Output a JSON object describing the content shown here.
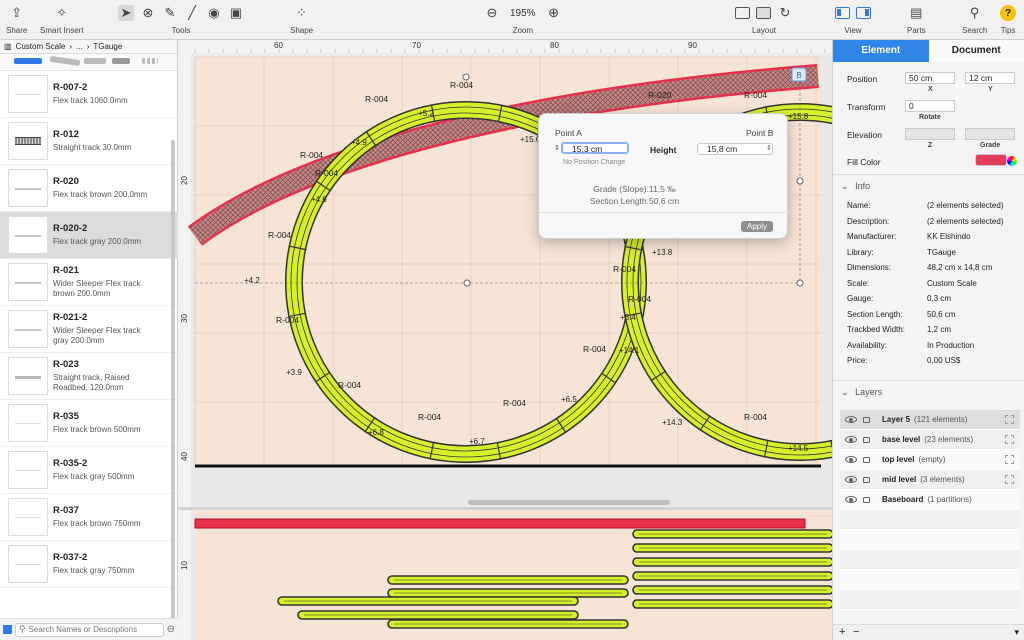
{
  "toolbar": {
    "share_label": "Share",
    "smart_insert_label": "Smart Insert",
    "tools_label": "Tools",
    "shape_label": "Shape",
    "zoom_label": "Zoom",
    "zoom_value": "195%",
    "layout_label": "Layout",
    "view_label": "View",
    "parts_label": "Parts",
    "search_label": "Search",
    "tips_label": "Tips"
  },
  "breadcrumb": {
    "root": "Custom Scale",
    "ellipsis": "...",
    "current": "TGauge"
  },
  "library": {
    "items": [
      {
        "title": "R-007-2",
        "desc": "Flex track 1060.0mm"
      },
      {
        "title": "R-012",
        "desc": "Straight track 30.0mm"
      },
      {
        "title": "R-020",
        "desc": "Flex track brown 200.0mm"
      },
      {
        "title": "R-020-2",
        "desc": "Flex track gray 200.0mm"
      },
      {
        "title": "R-021",
        "desc": "Wider Sleeper Flex track brown 200.0mm"
      },
      {
        "title": "R-021-2",
        "desc": "Wider Sleeper Flex track gray 200.0mm"
      },
      {
        "title": "R-023",
        "desc": "Straight track, Raised Roadbed, 120.0mm"
      },
      {
        "title": "R-035",
        "desc": "Flex track brown 500mm"
      },
      {
        "title": "R-035-2",
        "desc": "Flex track gray 500mm"
      },
      {
        "title": "R-037",
        "desc": "Flex track brown 750mm"
      },
      {
        "title": "R-037-2",
        "desc": "Flex track gray 750mm"
      }
    ],
    "selected_index": 3,
    "search_placeholder": "Search Names or Descriptions"
  },
  "canvas": {
    "ruler_top": [
      "60",
      "70",
      "80",
      "90"
    ],
    "ruler_left": [
      "20",
      "30",
      "40"
    ],
    "ruler_left_lower": [
      "10"
    ],
    "track_label": "R-004",
    "track_label_top": "R-020",
    "endpoint_badge": "B",
    "elevations": [
      "+5.2",
      "+4.9",
      "+4.6",
      "+4.2",
      "+3.9",
      "+6.8",
      "+6.7",
      "+6.5",
      "+15.6",
      "+15.8",
      "+13.8",
      "+6.4",
      "+14.1",
      "+14.3",
      "+14.5"
    ],
    "colors": {
      "track_fill": "#d6f02a",
      "track_stroke": "#333333",
      "highlight": "#e8304a",
      "board": "#f6e4d6"
    }
  },
  "popover": {
    "point_a_label": "Point A",
    "point_b_label": "Point B",
    "height_label": "Height",
    "point_a_value": "15,3 cm",
    "point_b_value": "15,8 cm",
    "no_position_change": "No Position Change",
    "grade_label": "Grade (Slope):",
    "grade_value": "11,5 ‰",
    "section_length_label": "Section Length:",
    "section_length_value": "50,6 cm",
    "apply_label": "Apply"
  },
  "inspector": {
    "tab_element": "Element",
    "tab_document": "Document",
    "position_label": "Position",
    "position_x": "50 cm",
    "position_y": "12 cm",
    "x_label": "X",
    "y_label": "Y",
    "transform_label": "Transform",
    "rotate_value": "0",
    "rotate_label": "Rotate",
    "elevation_label": "Elevation",
    "z_label": "Z",
    "grade_label": "Grade",
    "fill_color_label": "Fill Color",
    "fill_color": "#e23c5a",
    "info_header": "Info",
    "info": [
      {
        "k": "Name:",
        "v": "(2 elements selected)"
      },
      {
        "k": "Description:",
        "v": "(2 elements selected)"
      },
      {
        "k": "Manufacturer:",
        "v": "KK Elshindo"
      },
      {
        "k": "Library:",
        "v": "TGauge"
      },
      {
        "k": "Dimensions:",
        "v": "48,2 cm x 14,8 cm"
      },
      {
        "k": "Scale:",
        "v": "Custom Scale"
      },
      {
        "k": "Gauge:",
        "v": "0,3 cm"
      },
      {
        "k": "Section Length:",
        "v": "50,6 cm"
      },
      {
        "k": "Trackbed Width:",
        "v": "1,2 cm"
      },
      {
        "k": "Availability:",
        "v": "In Production"
      },
      {
        "k": "Price:",
        "v": "0,00 US$"
      }
    ],
    "layers_header": "Layers",
    "layers": [
      {
        "name": "Layer 5",
        "count": "(121 elements)"
      },
      {
        "name": "base level",
        "count": "(23 elements)"
      },
      {
        "name": "top level",
        "count": "(empty)"
      },
      {
        "name": "mid level",
        "count": "(3 elements)"
      },
      {
        "name": "Baseboard",
        "count": "(1 partitions)"
      }
    ],
    "add_label": "+",
    "remove_label": "−"
  }
}
